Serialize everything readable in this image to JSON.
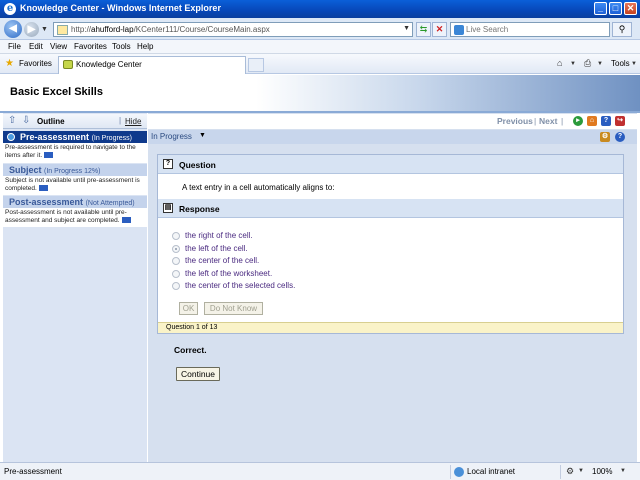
{
  "window": {
    "title": "Knowledge Center - Windows Internet Explorer",
    "minimize": "_",
    "maximize": "□",
    "close": "✕"
  },
  "address_bar": {
    "url_prefix": "http://",
    "url_host": "ahufford-lap",
    "url_path": "/KCenter111/Course/CourseMain.aspx",
    "search_placeholder": "Live Search"
  },
  "menu": [
    "File",
    "Edit",
    "View",
    "Favorites",
    "Tools",
    "Help"
  ],
  "favorites_bar": {
    "favorites_label": "Favorites",
    "tab_label": "Knowledge Center",
    "tools_label": "Tools"
  },
  "header": {
    "course_title": "Basic Excel Skills"
  },
  "sidebar": {
    "outline_label": "Outline",
    "separator": "|",
    "hide_label": "Hide",
    "items": [
      {
        "name": "Pre-assessment",
        "status": "(In Progress)",
        "desc": "Pre-assessment is required to navigate to the items after it."
      },
      {
        "name": "Subject",
        "status": "(In Progress 12%)",
        "desc": "Subject is not available until pre-assessment is completed."
      },
      {
        "name": "Post-assessment",
        "status": "(Not Attempted)",
        "desc": "Post-assessment is not available until pre-assessment and subject are completed."
      }
    ]
  },
  "content_nav": {
    "previous": "Previous",
    "sep1": "|",
    "next": "Next",
    "sep2": "|",
    "status": "In Progress"
  },
  "question": {
    "section_label": "Question",
    "text": "A text entry in a cell automatically aligns to:"
  },
  "response": {
    "section_label": "Response",
    "options": [
      "the right of the cell.",
      "the left of the cell.",
      "the center of the cell.",
      "the left of the worksheet.",
      "the center of the selected cells."
    ],
    "selected_index": 1,
    "ok_label": "OK",
    "dont_know_label": "Do Not Know",
    "counter": "Question 1 of 13"
  },
  "feedback": {
    "result": "Correct.",
    "continue_label": "Continue"
  },
  "statusbar": {
    "text": "Pre-assessment",
    "zone": "Local intranet",
    "zoom": "100%"
  },
  "colors": {
    "ie_titlebar": "#0747b8",
    "active_outline_item": "#0f3a8c",
    "panel_header": "#d7e3f3",
    "counter_bg": "#faf3c8"
  }
}
